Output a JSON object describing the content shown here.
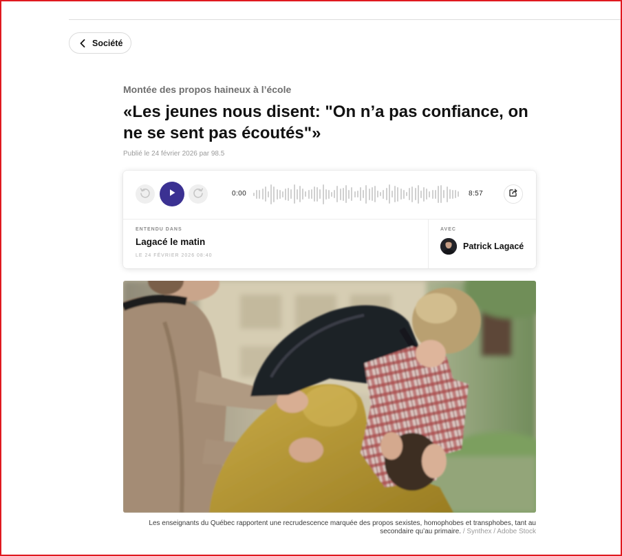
{
  "colors": {
    "frame": "#e0191f",
    "accent": "#3b3192"
  },
  "nav": {
    "back_label": "Société",
    "back_icon": "chevron-left-icon"
  },
  "article": {
    "kicker": "Montée des propos haineux à l’école",
    "title": "«Les jeunes nous disent: \"On n’a pas confiance, on ne se sent pas écoutés\"»",
    "byline": "Publié le 24 février 2026 par 98.5"
  },
  "player": {
    "rewind_icon": "rewind-icon",
    "play_icon": "play-icon",
    "forward_icon": "forward-icon",
    "share_icon": "share-icon",
    "current_time": "0:00",
    "duration": "8:57",
    "heard_in_label": "ENTENDU DANS",
    "show_name": "Lagacé le matin",
    "air_date": "LE 24 FÉVRIER 2026 08:40",
    "with_label": "AVEC",
    "host_name": "Patrick Lagacé"
  },
  "photo": {
    "caption": "Les enseignants du Québec rapportent une recrudescence marquée des propos sexistes, homophobes et transphobes, tant au secondaire qu’au primaire.",
    "credit": "/ Synthex / Adobe Stock"
  }
}
